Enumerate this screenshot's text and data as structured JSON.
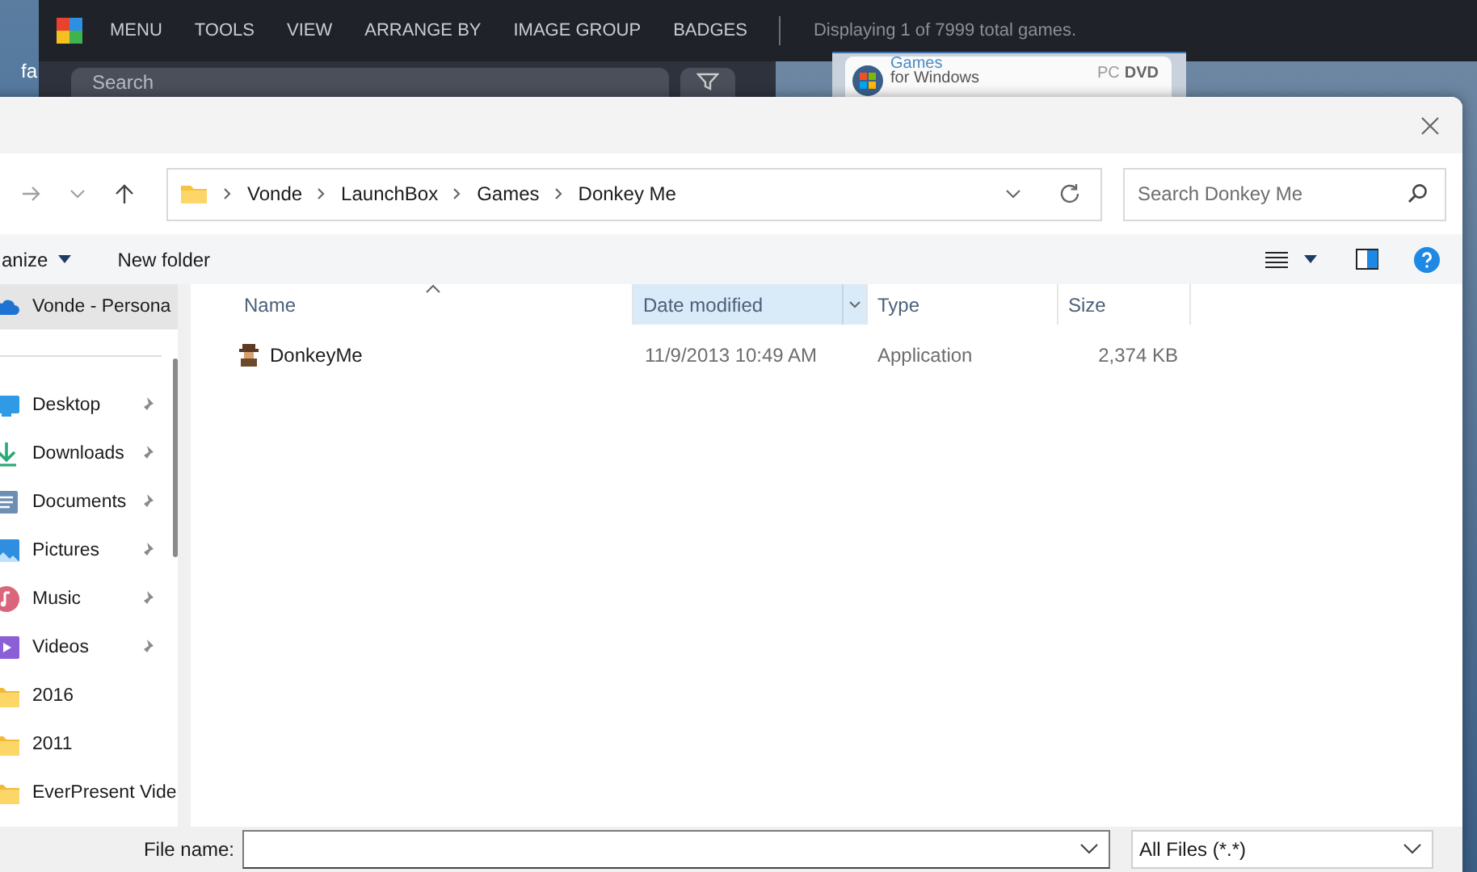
{
  "desktop": {
    "label": "fa"
  },
  "app": {
    "menu": [
      "MENU",
      "TOOLS",
      "VIEW",
      "ARRANGE BY",
      "IMAGE GROUP",
      "BADGES"
    ],
    "status": "Displaying 1 of 7999 total games.",
    "search": {
      "placeholder": "Search"
    },
    "box_art": {
      "title": "Games",
      "subtitle": "for Windows",
      "platform": "PC",
      "media": "DVD"
    }
  },
  "dialog": {
    "address": {
      "path": [
        "Vonde",
        "LaunchBox",
        "Games",
        "Donkey Me"
      ]
    },
    "search": {
      "placeholder": "Search Donkey Me"
    },
    "commands": [
      {
        "label": "anize",
        "kind": "menu"
      },
      {
        "label": "New folder",
        "kind": "button"
      }
    ],
    "sidebar": {
      "items": [
        {
          "label": "Vonde - Persona",
          "kind": "cloud",
          "pinned": false,
          "selected": true
        },
        {
          "label": "Desktop",
          "kind": "desktop",
          "pinned": true,
          "selected": false
        },
        {
          "label": "Downloads",
          "kind": "downloads",
          "pinned": true,
          "selected": false
        },
        {
          "label": "Documents",
          "kind": "documents",
          "pinned": true,
          "selected": false
        },
        {
          "label": "Pictures",
          "kind": "pictures",
          "pinned": true,
          "selected": false
        },
        {
          "label": "Music",
          "kind": "music",
          "pinned": true,
          "selected": false
        },
        {
          "label": "Videos",
          "kind": "videos",
          "pinned": true,
          "selected": false
        },
        {
          "label": "2016",
          "kind": "folder",
          "pinned": false,
          "selected": false
        },
        {
          "label": "2011",
          "kind": "folder",
          "pinned": false,
          "selected": false
        },
        {
          "label": "EverPresent Vide",
          "kind": "folder",
          "pinned": false,
          "selected": false
        }
      ]
    },
    "columns": [
      {
        "label": "Name",
        "sorted": true,
        "selected": false
      },
      {
        "label": "Date modified",
        "sorted": false,
        "selected": true
      },
      {
        "label": "Type",
        "sorted": false,
        "selected": false
      },
      {
        "label": "Size",
        "sorted": false,
        "selected": false
      }
    ],
    "files": [
      {
        "name": "DonkeyMe",
        "date": "11/9/2013 10:49 AM",
        "type": "Application",
        "size": "2,374 KB"
      }
    ],
    "footer": {
      "file_name_label": "File name:",
      "filter": "All Files (*.*)"
    }
  }
}
